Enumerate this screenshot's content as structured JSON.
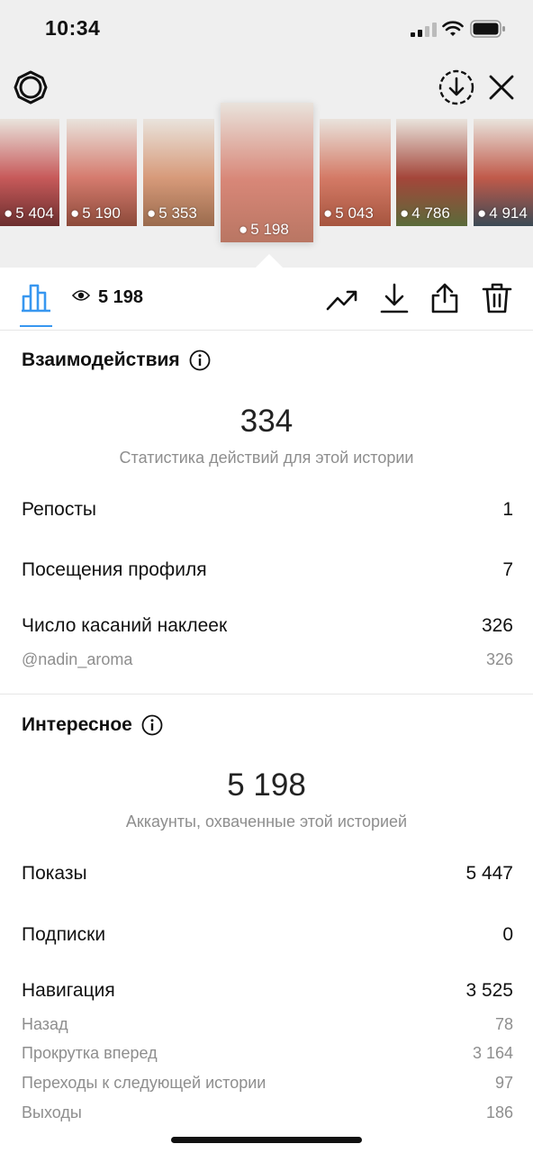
{
  "status_bar": {
    "time": "10:34"
  },
  "stories": [
    {
      "views": "5 404",
      "selected": false,
      "colors": [
        "#6b2e2e",
        "#c75a5a"
      ]
    },
    {
      "views": "5 190",
      "selected": false,
      "colors": [
        "#8c4a3a",
        "#d57b6e"
      ]
    },
    {
      "views": "5 353",
      "selected": false,
      "colors": [
        "#9a6b4d",
        "#d79a7a"
      ]
    },
    {
      "views": "5 198",
      "selected": true,
      "colors": [
        "#b97663",
        "#d88778"
      ]
    },
    {
      "views": "5 043",
      "selected": false,
      "colors": [
        "#a6553f",
        "#d47a66"
      ]
    },
    {
      "views": "4 786",
      "selected": false,
      "colors": [
        "#5a6b3a",
        "#a4463a"
      ]
    },
    {
      "views": "4 914",
      "selected": false,
      "colors": [
        "#3b4a55",
        "#c05a4a"
      ]
    }
  ],
  "toolbar": {
    "views_total": "5 198",
    "accent": "#3897f0"
  },
  "interactions": {
    "title": "Взаимодействия",
    "total": "334",
    "caption": "Статистика действий для этой истории",
    "rows": [
      {
        "label": "Репосты",
        "value": "1"
      },
      {
        "label": "Посещения профиля",
        "value": "7"
      },
      {
        "label": "Число касаний наклеек",
        "value": "326"
      }
    ],
    "sub_rows": [
      {
        "label": "@nadin_aroma",
        "value": "326"
      }
    ]
  },
  "discovery": {
    "title": "Интересное",
    "total": "5 198",
    "caption": "Аккаунты, охваченные этой историей",
    "rows": [
      {
        "label": "Показы",
        "value": "5 447"
      },
      {
        "label": "Подписки",
        "value": "0"
      },
      {
        "label": "Навигация",
        "value": "3 525"
      }
    ],
    "sub_rows": [
      {
        "label": "Назад",
        "value": "78"
      },
      {
        "label": "Прокрутка вперед",
        "value": "3 164"
      },
      {
        "label": "Переходы к следующей истории",
        "value": "97"
      },
      {
        "label": "Выходы",
        "value": "186"
      }
    ]
  },
  "icons": [
    "signal-icon",
    "wifi-icon",
    "battery-icon",
    "settings-icon",
    "download-circle-icon",
    "close-icon",
    "bar-chart-icon",
    "eye-icon",
    "trend-icon",
    "download-icon",
    "share-icon",
    "trash-icon",
    "info-icon"
  ]
}
